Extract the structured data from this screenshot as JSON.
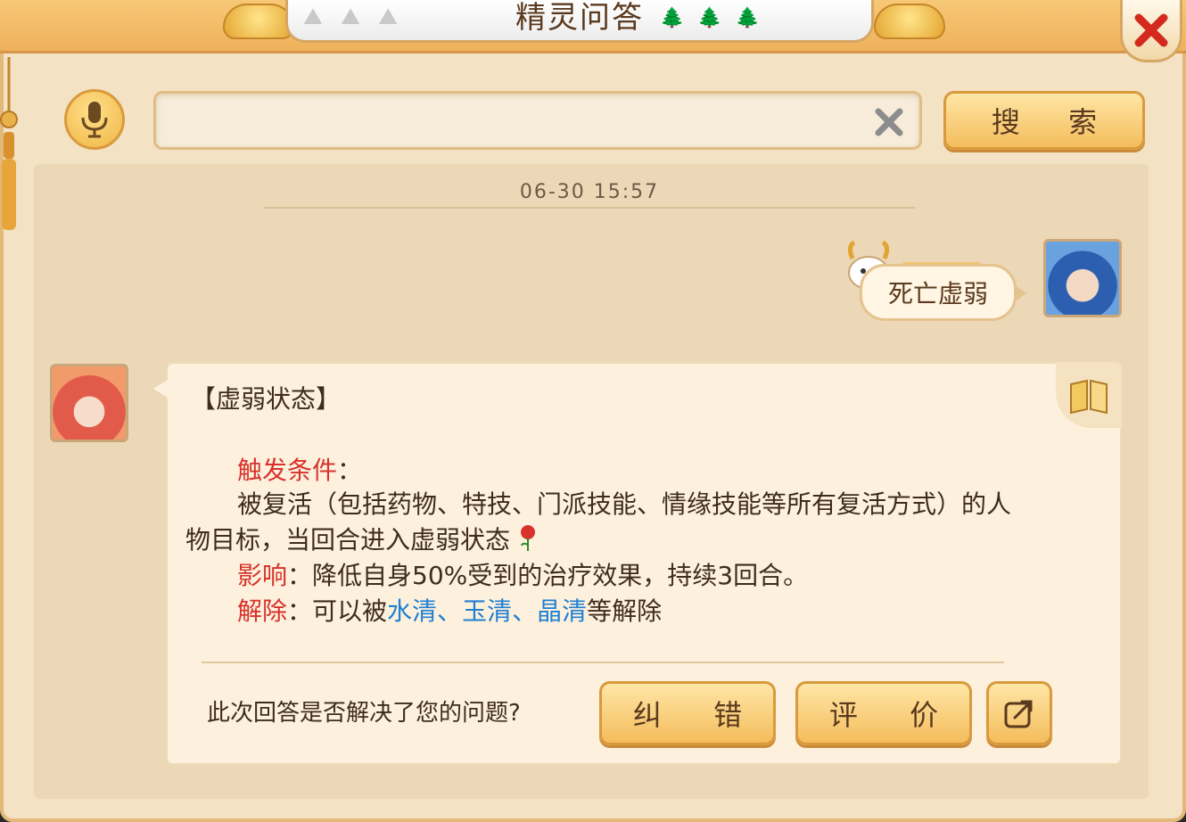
{
  "window": {
    "title": "精灵问答"
  },
  "search": {
    "value": "",
    "button_label": "搜 索"
  },
  "chat": {
    "timestamp": "06-30 15:57",
    "user_message": "死亡虚弱",
    "answer": {
      "heading": "【虚弱状态】",
      "trigger_label": "触发条件",
      "trigger_colon": "：",
      "trigger_text_1": "被复活（包括药物、特技、门派技能、情缘技能等所有复活方式）的人",
      "trigger_text_2": "物目标，当回合进入虚弱状态",
      "effect_label": "影响",
      "effect_text": "：降低自身50%受到的治疗效果，持续3回合。",
      "remove_label": "解除",
      "remove_prefix": "：可以被",
      "remove_links": [
        "水清",
        "、",
        "玉清",
        "、",
        "晶清"
      ],
      "remove_suffix": "等解除"
    },
    "feedback": {
      "question": "此次回答是否解决了您的问题?",
      "correct_label": "纠 错",
      "rate_label": "评 价"
    }
  },
  "colors": {
    "accent_red": "#d8322a",
    "link_blue": "#1f7fd1",
    "button_gold": "#f4bd5c"
  },
  "icons": {
    "close": "close-icon",
    "mic": "microphone-icon",
    "clear": "clear-icon",
    "share": "share-icon",
    "book": "book-icon",
    "rose": "rose-icon"
  }
}
